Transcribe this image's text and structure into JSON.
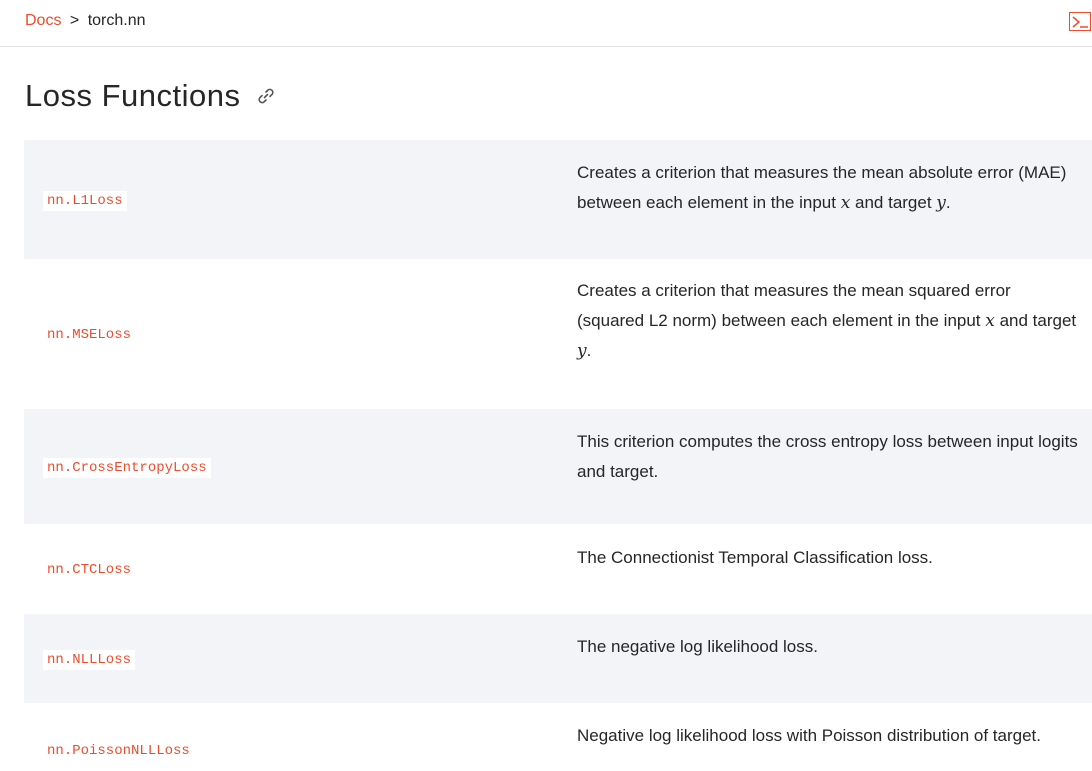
{
  "breadcrumb": {
    "root": "Docs",
    "separator": ">",
    "current": "torch.nn"
  },
  "page": {
    "title": "Loss Functions"
  },
  "rows": [
    {
      "name": "nn.L1Loss",
      "desc_before": "Creates a criterion that measures the mean absolute error (MAE) between each element in the input ",
      "var1": "x",
      "desc_middle": " and target ",
      "var2": "y",
      "desc_after": "."
    },
    {
      "name": "nn.MSELoss",
      "desc_before": "Creates a criterion that measures the mean squared error (squared L2 norm) between each element in the input ",
      "var1": "x",
      "desc_middle": " and target ",
      "var2": "y",
      "desc_after": "."
    },
    {
      "name": "nn.CrossEntropyLoss",
      "desc": "This criterion computes the cross entropy loss between input logits and target."
    },
    {
      "name": "nn.CTCLoss",
      "desc": "The Connectionist Temporal Classification loss."
    },
    {
      "name": "nn.NLLLoss",
      "desc": "The negative log likelihood loss."
    },
    {
      "name": "nn.PoissonNLLLoss",
      "desc": "Negative log likelihood loss with Poisson distribution of target."
    }
  ],
  "colors": {
    "accent": "#ee4c2c",
    "row_shade": "#f3f4f7",
    "text": "#262626"
  },
  "icons": {
    "terminal": "terminal-icon",
    "anchor": "link-icon"
  }
}
